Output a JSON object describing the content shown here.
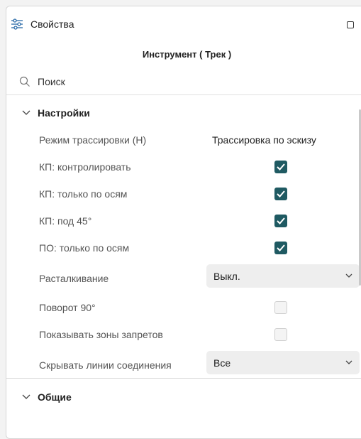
{
  "header": {
    "title": "Свойства",
    "icon": "properties-sliders-icon",
    "window_button": "restore-window-icon"
  },
  "tool_title": "Инструмент ( Трек )",
  "search": {
    "placeholder": "Поиск",
    "value": ""
  },
  "sections": [
    {
      "label": "Настройки",
      "expanded": true
    },
    {
      "label": "Общие",
      "expanded": true
    }
  ],
  "settings": [
    {
      "name": "Режим трассировки (H)",
      "kind": "text",
      "value": "Трассировка по эскизу"
    },
    {
      "name": "КП: контролировать",
      "kind": "checkbox",
      "checked": true
    },
    {
      "name": "КП: только по осям",
      "kind": "checkbox",
      "checked": true
    },
    {
      "name": "КП: под 45°",
      "kind": "checkbox",
      "checked": true
    },
    {
      "name": "ПО: только по осям",
      "kind": "checkbox",
      "checked": true
    },
    {
      "name": "Расталкивание",
      "kind": "select",
      "value": "Выкл."
    },
    {
      "name": "Поворот 90°",
      "kind": "checkbox",
      "checked": false
    },
    {
      "name": "Показывать зоны запретов",
      "kind": "checkbox",
      "checked": false
    },
    {
      "name": "Скрывать линии соединения",
      "kind": "select",
      "value": "Все"
    }
  ],
  "colors": {
    "checkbox_on": "#1f5a62",
    "select_bg": "#eeeeee",
    "label": "#555555"
  }
}
